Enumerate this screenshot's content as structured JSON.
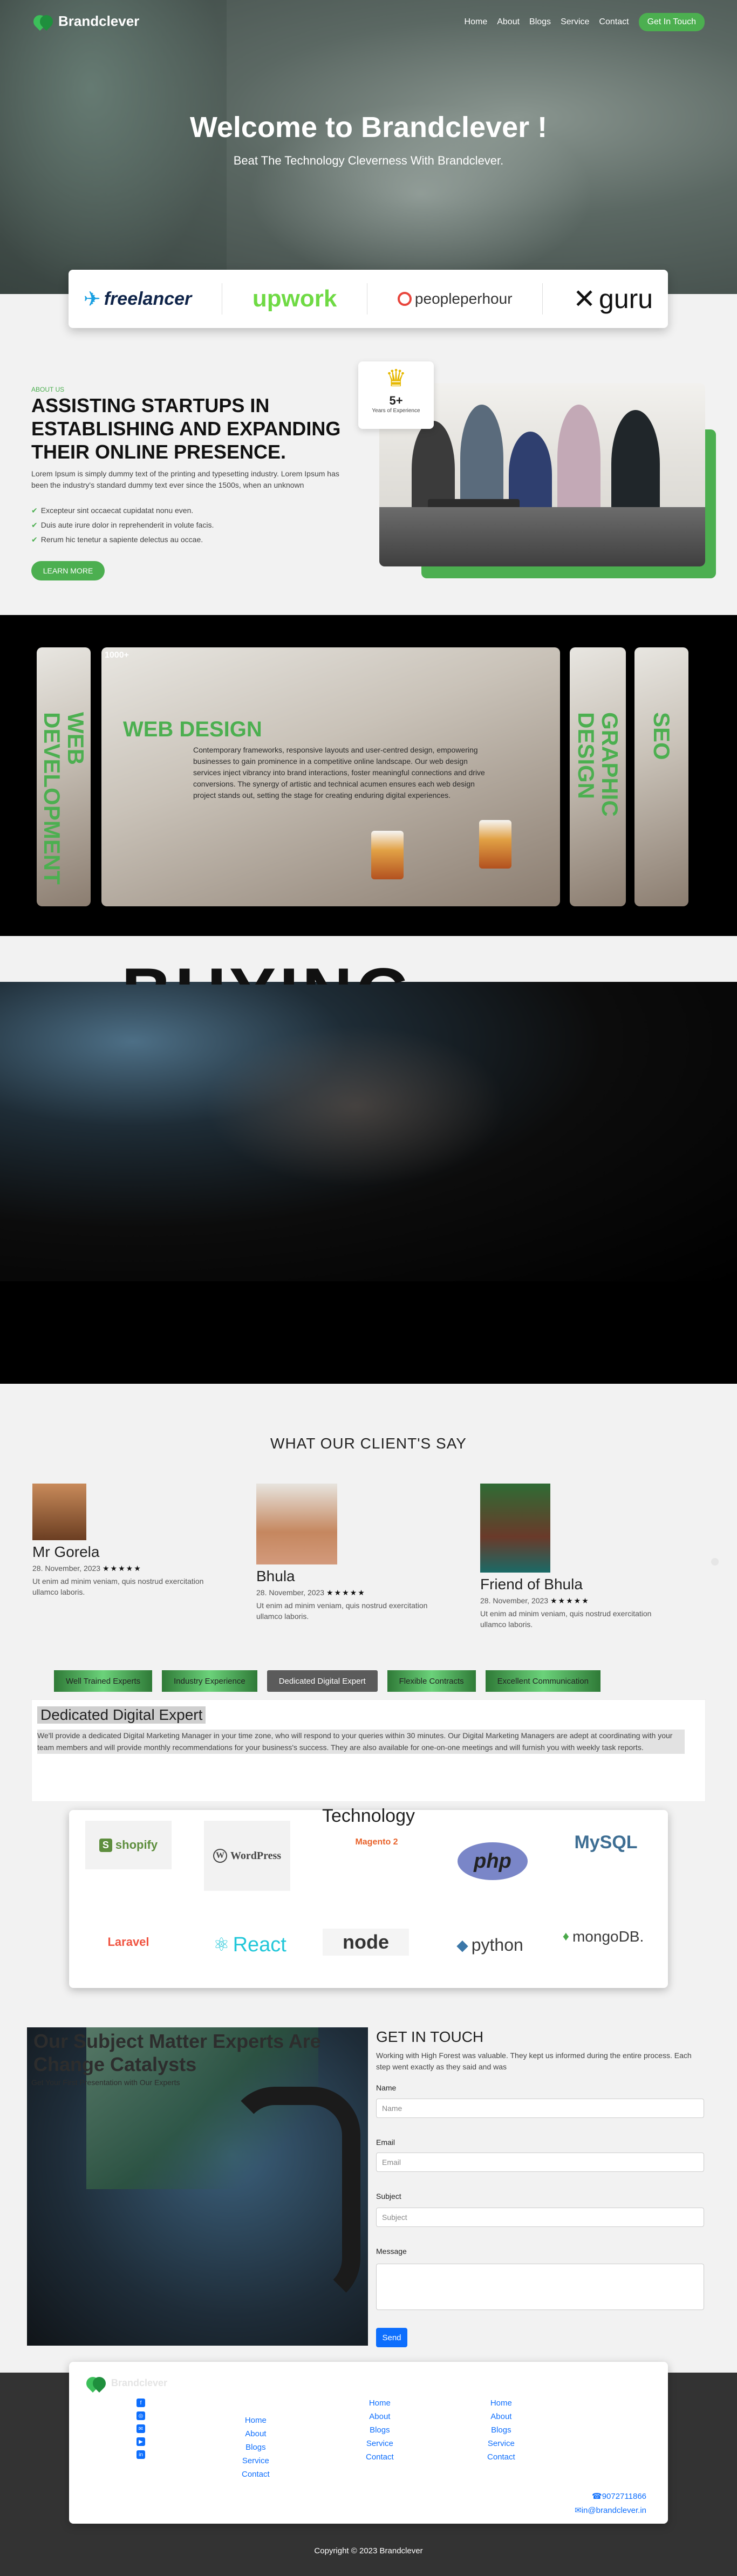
{
  "nav": {
    "brand": "Brandclever",
    "links": [
      "Home",
      "About",
      "Blogs",
      "Service",
      "Contact"
    ],
    "cta": "Get In Touch"
  },
  "hero": {
    "title": "Welcome to Brandclever !",
    "subtitle": "Beat The Technology Cleverness With Brandclever."
  },
  "partners": [
    "freelancer",
    "upwork",
    "peopleperhour",
    "guru"
  ],
  "about": {
    "kicker": "ABOUT US",
    "title": "ASSISTING STARTUPS IN ESTABLISHING AND EXPANDING THEIR ONLINE PRESENCE.",
    "text": "Lorem Ipsum is simply dummy text of the printing and typesetting industry. Lorem Ipsum has been the industry's standard dummy text ever since the 1500s, when an unknown",
    "list": [
      "Excepteur sint occaecat cupidatat nonu even.",
      "Duis aute irure dolor in reprehenderit in volute facis.",
      "Rerum hic tenetur a sapiente delectus au occae."
    ],
    "button": "LEARN MORE",
    "badge": {
      "number": "5+",
      "label": "Years of Experience"
    }
  },
  "services": {
    "corner": "1000+",
    "left": "WEB DEVELOPMENT",
    "main_title": "WEB DESIGN",
    "main_text": "Contemporary frameworks, responsive layouts and user-centred design, empowering businesses to gain prominence in a competitive online landscape. Our web design services inject vibrancy into brand interactions, foster meaningful connections and drive conversions. The synergy of artistic and technical acumen ensures each web design project stands out, setting the stage for creating enduring digital experiences.",
    "right1": "GRAPHIC DESIGN",
    "right2": "SEO"
  },
  "banner": {
    "word": "BUYING"
  },
  "testimonials": {
    "title": "WHAT OUR CLIENT'S SAY",
    "items": [
      {
        "name": "Mr Gorela",
        "date": "28. November, 2023",
        "stars": "★★★★★",
        "text": "Ut enim ad minim veniam, quis nostrud exercitation ullamco laboris."
      },
      {
        "name": "Bhula",
        "date": "28. November, 2023",
        "stars": "★★★★★",
        "text": "Ut enim ad minim veniam, quis nostrud exercitation ullamco laboris."
      },
      {
        "name": "Friend of Bhula",
        "date": "28. November, 2023",
        "stars": "★★★★★",
        "text": "Ut enim ad minim veniam, quis nostrud exercitation ullamco laboris."
      }
    ]
  },
  "tabs": {
    "items": [
      "Well Trained Experts",
      "Industry Experience",
      "Dedicated Digital Expert",
      "Flexible Contracts",
      "Excellent Communication"
    ],
    "active": "Dedicated Digital Expert",
    "panel_title": "Dedicated Digital Expert",
    "panel_text": "We'll provide a dedicated Digital Marketing Manager in your time zone, who will respond to your queries within 30 minutes. Our Digital Marketing Managers are adept at coordinating with your team members and will provide monthly recommendations for your business's success. They are also available for one-on-one meetings and will furnish you with weekly task reports."
  },
  "technology": {
    "title": "Technology",
    "logos": [
      "shopify",
      "WordPress",
      "Magento 2",
      "php",
      "MySQL",
      "Laravel",
      "React",
      "node",
      "python",
      "mongoDB."
    ]
  },
  "contact": {
    "title": "Our Subject Matter Experts Are Change Catalysts",
    "sub": "Get Your First Presentation with Our Experts",
    "form_title": "GET IN TOUCH",
    "form_desc": "Working with High Forest was valuable. They kept us informed during the entire process. Each step went exactly as they said and was",
    "labels": {
      "name": "Name",
      "email": "Email",
      "subject": "Subject",
      "message": "Message"
    },
    "placeholders": {
      "name": "Name",
      "email": "Email",
      "subject": "Subject"
    },
    "send": "Send"
  },
  "footer": {
    "brand": "Brandclever",
    "col1": [
      "Home",
      "About",
      "Blogs",
      "Service",
      "Contact"
    ],
    "col2": [
      "Home",
      "About",
      "Blogs",
      "Service",
      "Contact"
    ],
    "col3": [
      "Home",
      "About",
      "Blogs",
      "Service",
      "Contact"
    ],
    "phone": "9072711866",
    "email": "in@brandclever.in",
    "copyright": "Copyright © 2023 Brandclever"
  },
  "colors": {
    "accent": "#4caf50",
    "link": "#0d6efd",
    "footer_bg": "#333333"
  }
}
